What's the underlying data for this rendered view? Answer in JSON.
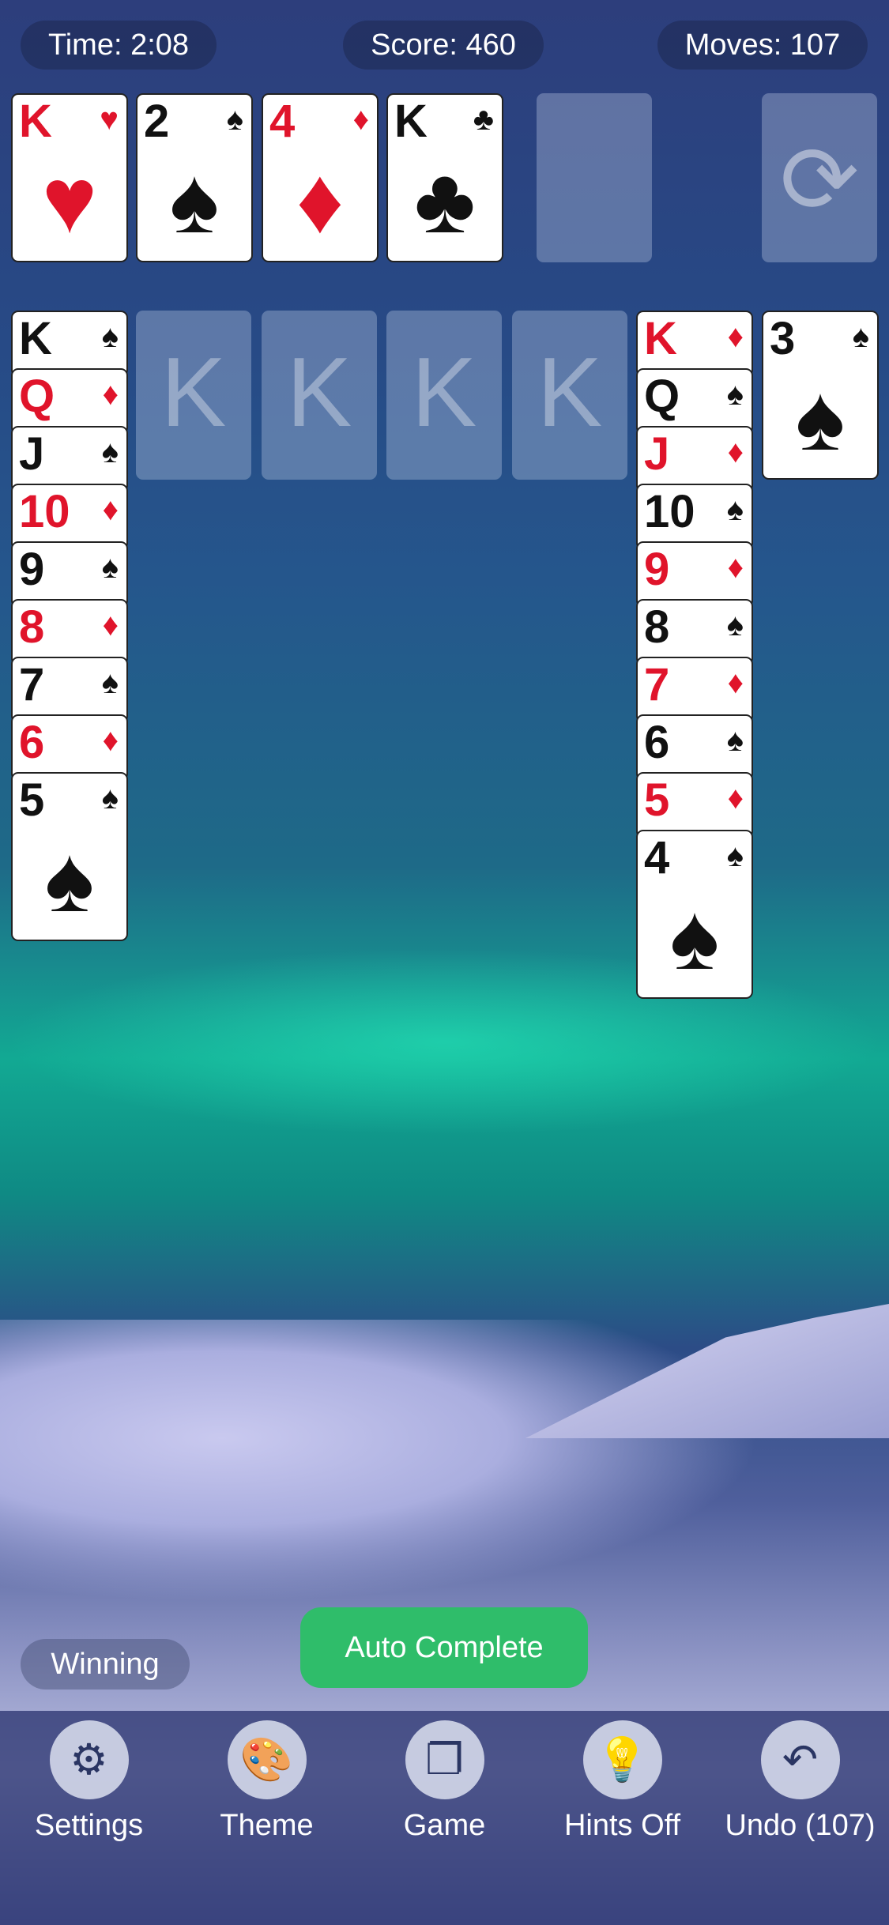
{
  "status": {
    "time": "Time: 2:08",
    "score": "Score: 460",
    "moves": "Moves: 107"
  },
  "foundations": [
    {
      "rank": "K",
      "suit": "♥",
      "color": "red"
    },
    {
      "rank": "2",
      "suit": "♠",
      "color": "black"
    },
    {
      "rank": "4",
      "suit": "♦",
      "color": "red"
    },
    {
      "rank": "K",
      "suit": "♣",
      "color": "black"
    }
  ],
  "stock": {
    "icon": "recycle-icon",
    "glyph": "⟳"
  },
  "tableau": {
    "col1": [
      {
        "rank": "K",
        "suit": "♠",
        "color": "black"
      },
      {
        "rank": "Q",
        "suit": "♦",
        "color": "red"
      },
      {
        "rank": "J",
        "suit": "♠",
        "color": "black"
      },
      {
        "rank": "10",
        "suit": "♦",
        "color": "red"
      },
      {
        "rank": "9",
        "suit": "♠",
        "color": "black"
      },
      {
        "rank": "8",
        "suit": "♦",
        "color": "red"
      },
      {
        "rank": "7",
        "suit": "♠",
        "color": "black"
      },
      {
        "rank": "6",
        "suit": "♦",
        "color": "red"
      },
      {
        "rank": "5",
        "suit": "♠",
        "color": "black"
      }
    ],
    "empty_slot_label": "K",
    "col6": [
      {
        "rank": "K",
        "suit": "♦",
        "color": "red"
      },
      {
        "rank": "Q",
        "suit": "♠",
        "color": "black"
      },
      {
        "rank": "J",
        "suit": "♦",
        "color": "red"
      },
      {
        "rank": "10",
        "suit": "♠",
        "color": "black"
      },
      {
        "rank": "9",
        "suit": "♦",
        "color": "red"
      },
      {
        "rank": "8",
        "suit": "♠",
        "color": "black"
      },
      {
        "rank": "7",
        "suit": "♦",
        "color": "red"
      },
      {
        "rank": "6",
        "suit": "♠",
        "color": "black"
      },
      {
        "rank": "5",
        "suit": "♦",
        "color": "red"
      },
      {
        "rank": "4",
        "suit": "♠",
        "color": "black"
      }
    ],
    "col7": [
      {
        "rank": "3",
        "suit": "♠",
        "color": "black"
      }
    ]
  },
  "auto_complete_label": "Auto Complete",
  "winning_label": "Winning",
  "toolbar": [
    {
      "label": "Settings",
      "icon": "gear-icon",
      "glyph": "⚙"
    },
    {
      "label": "Theme",
      "icon": "palette-icon",
      "glyph": "🎨"
    },
    {
      "label": "Game",
      "icon": "cards-icon",
      "glyph": "❐"
    },
    {
      "label": "Hints Off",
      "icon": "lightbulb-icon",
      "glyph": "💡"
    },
    {
      "label": "Undo (107)",
      "icon": "undo-icon",
      "glyph": "↶"
    }
  ],
  "colors": {
    "red": "#e0142b",
    "black": "#111111",
    "accent": "#2fbd6a"
  }
}
